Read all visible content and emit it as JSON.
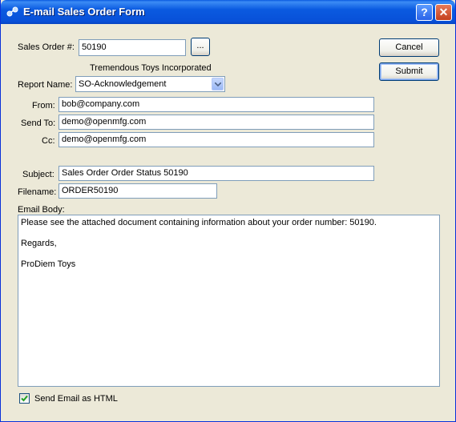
{
  "window": {
    "title": "E-mail Sales Order Form",
    "help_label": "?",
    "close_label": "✕"
  },
  "order": {
    "label": "Sales Order #:",
    "value": "50190",
    "lookup_label": "...",
    "customer_name": "Tremendous Toys Incorporated"
  },
  "report": {
    "label": "Report Name:",
    "selected": "SO-Acknowledgement"
  },
  "fields": {
    "from_label": "From:",
    "from_value": "bob@company.com",
    "sendto_label": "Send To:",
    "sendto_value": "demo@openmfg.com",
    "cc_label": "Cc:",
    "cc_value": "demo@openmfg.com",
    "subject_label": "Subject:",
    "subject_value": "Sales Order Order Status 50190",
    "filename_label": "Filename:",
    "filename_value": "ORDER50190"
  },
  "email_body": {
    "label": "Email Body:",
    "line1": "Please see the attached document containing information about your order number: 50190.",
    "line2": "Regards,",
    "line3": "ProDiem Toys"
  },
  "html_option": {
    "label": "Send Email as HTML",
    "checked": true
  },
  "actions": {
    "cancel_label": "Cancel",
    "submit_label": "Submit"
  }
}
